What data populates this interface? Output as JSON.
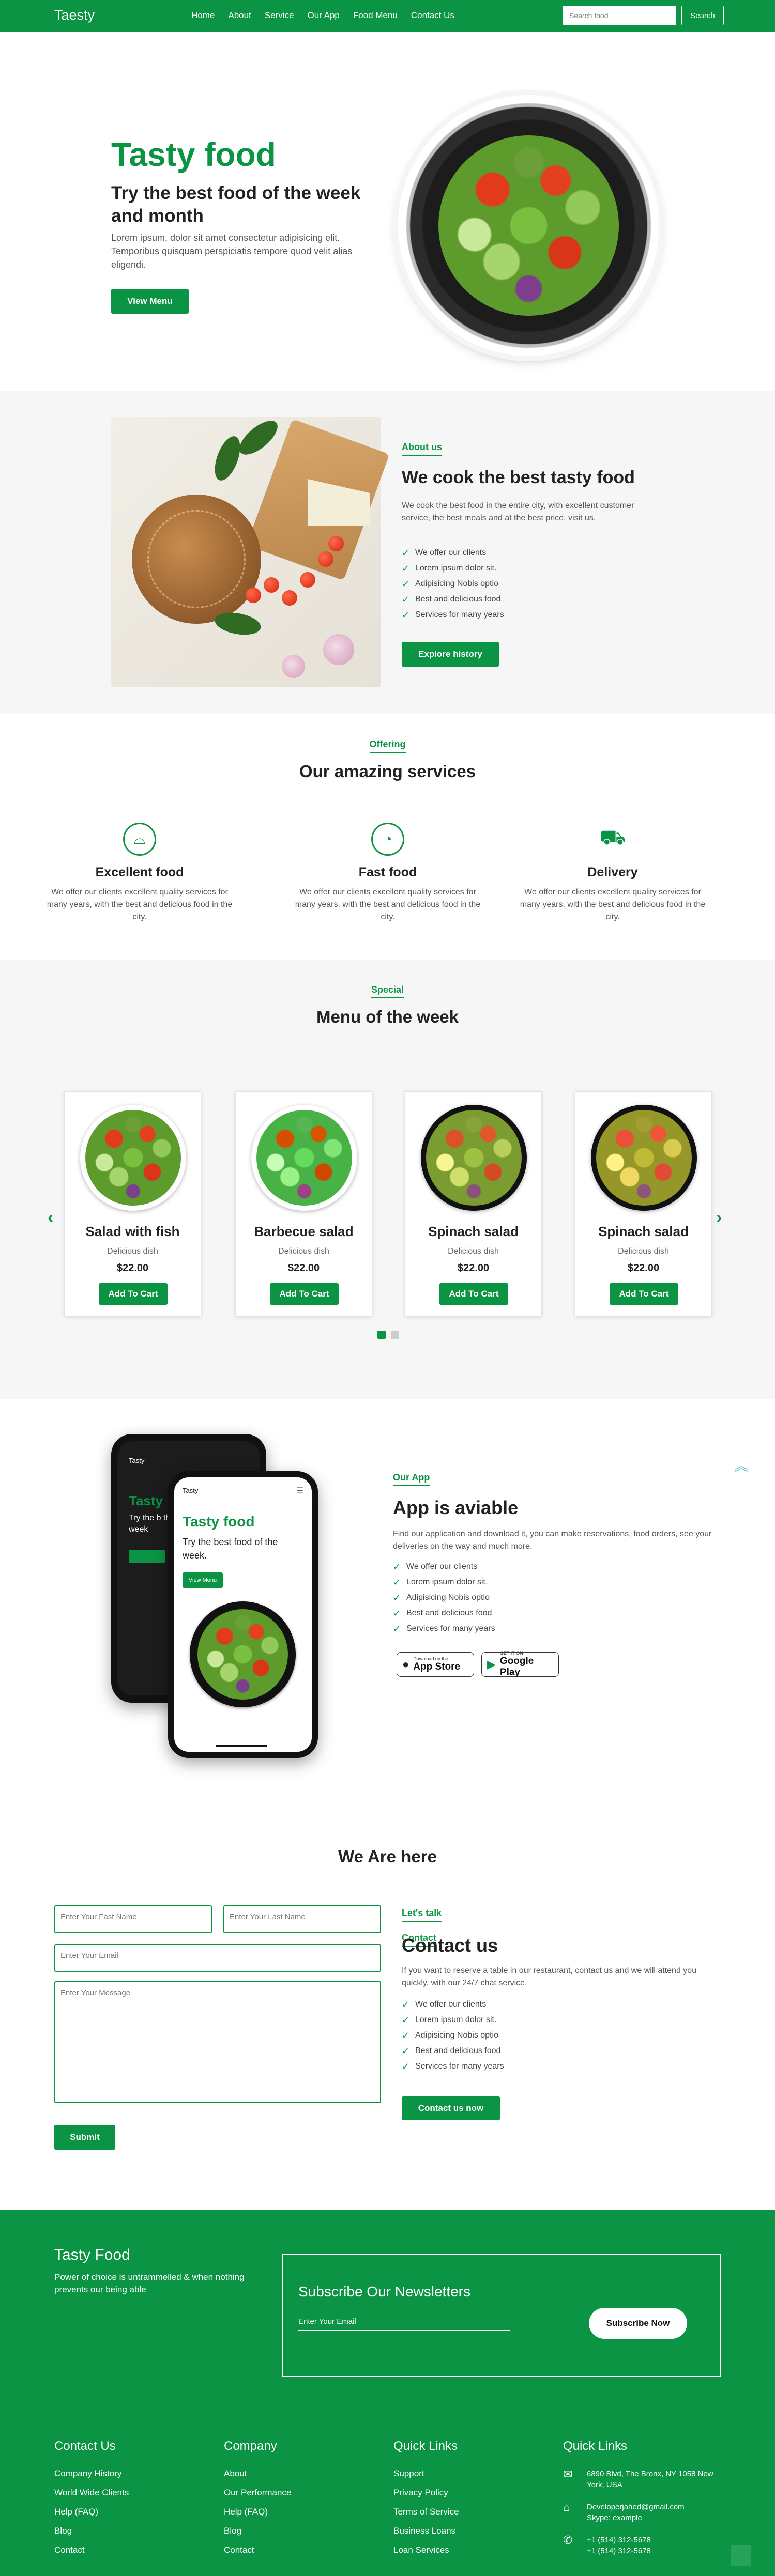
{
  "nav": {
    "brand": "Taesty",
    "links": [
      "Home",
      "About",
      "Service",
      "Our App",
      "Food Menu",
      "Contact Us"
    ],
    "search_placeholder": "Search food",
    "search_button": "Search"
  },
  "hero": {
    "title": "Tasty food",
    "subtitle": "Try the best food of the week and month",
    "text": "Lorem ipsum, dolor sit amet consectetur adipisicing elit. Temporibus quisquam perspiciatis tempore quod velit alias eligendi.",
    "button": "View Menu"
  },
  "about": {
    "tag": "About us",
    "title": "We cook the best tasty food",
    "text": "We cook the best food in the entire city, with excellent customer service, the best meals and at the best price, visit us.",
    "checks": [
      "We offer our clients",
      "Lorem ipsum dolor sit.",
      "Adipisicing Nobis optio",
      "Best and delicious food",
      "Services for many years"
    ],
    "button": "Explore history"
  },
  "services": {
    "tag": "Offering",
    "title": "Our amazing services",
    "items": [
      {
        "title": "Excellent food",
        "text": "We offer our clients excellent quality services for many years, with the best and delicious food in the city.",
        "icon": "food-dome-icon"
      },
      {
        "title": "Fast food",
        "text": "We offer our clients excellent quality services for many years, with the best and delicious food in the city.",
        "icon": "pizza-icon"
      },
      {
        "title": "Delivery",
        "text": "We offer our clients excellent quality services for many years, with the best and delicious food in the city.",
        "icon": "delivery-truck-icon"
      }
    ]
  },
  "menu": {
    "tag": "Special",
    "title": "Menu of the week",
    "items": [
      {
        "name": "Salad with fish",
        "sub": "Delicious dish",
        "price": "$22.00",
        "button": "Add To Cart"
      },
      {
        "name": "Barbecue salad",
        "sub": "Delicious dish",
        "price": "$22.00",
        "button": "Add To Cart"
      },
      {
        "name": "Spinach salad",
        "sub": "Delicious dish",
        "price": "$22.00",
        "button": "Add To Cart"
      },
      {
        "name": "Spinach salad",
        "sub": "Delicious dish",
        "price": "$22.00",
        "button": "Add To Cart"
      }
    ],
    "prev": "‹",
    "next": "›"
  },
  "app": {
    "tag": "Our App",
    "title": "App is aviable",
    "text": "Find our application and download it, you can make reservations, food orders, see your deliveries on the way and much more.",
    "checks": [
      "We offer our clients",
      "Lorem ipsum dolor sit.",
      "Adipisicing Nobis optio",
      "Best and delicious food",
      "Services for many years"
    ],
    "appstore_small": "Download on the",
    "appstore": "App Store",
    "googleplay_small": "GET IT ON",
    "googleplay": "Google Play",
    "phone_brand": "Tasty",
    "phone_title": "Tasty food",
    "phone_subtitle": "Try the best food of the week.",
    "phone_button": "View Menu",
    "back_phone_title": "Tasty",
    "back_phone_subtitle": "Try the b the week"
  },
  "contact": {
    "tag": "Contact",
    "title": "We Are here",
    "first_name_placeholder": "Enter Your Fast Name",
    "last_name_placeholder": "Enter Your Last Name",
    "email_placeholder": "Enter Your Email",
    "message_placeholder": "Enter Your Message",
    "submit": "Submit",
    "side_tag": "Let's talk",
    "side_title": "Contact us",
    "side_text": "If you want to reserve a table in our restaurant, contact us and we will attend you quickly, with our 24/7 chat service.",
    "checks": [
      "We offer our clients",
      "Lorem ipsum dolor sit.",
      "Adipisicing Nobis optio",
      "Best and delicious food",
      "Services for many years"
    ],
    "side_button": "Contact us now"
  },
  "newsletter": {
    "brand": "Tasty Food",
    "text": "Power of choice is untrammelled & when nothing prevents our being able",
    "title": "Subscribe Our Newsletters",
    "email_placeholder": "Enter Your Email",
    "button": "Subscribe Now"
  },
  "footer": {
    "col1": {
      "title": "Contact Us",
      "links": [
        "Company History",
        "World Wide Clients",
        "Help (FAQ)",
        "Blog",
        "Contact"
      ]
    },
    "col2": {
      "title": "Company",
      "links": [
        "About",
        "Our Performance",
        "Help (FAQ)",
        "Blog",
        "Contact"
      ]
    },
    "col3": {
      "title": "Quick Links",
      "links": [
        "Support",
        "Privacy Policy",
        "Terms of Service",
        "Business Loans",
        "Loan Services"
      ]
    },
    "col4": {
      "title": "Quick Links",
      "address": "6890 Blvd, The Bronx, NY 1058 New York, USA",
      "email": "Developerjahed@gmail.com",
      "skype": "Skype: example",
      "phone1": "+1 (514) 312-5678",
      "phone2": "+1 (514) 312-5678"
    }
  },
  "colors": {
    "accent": "#0b9444"
  }
}
